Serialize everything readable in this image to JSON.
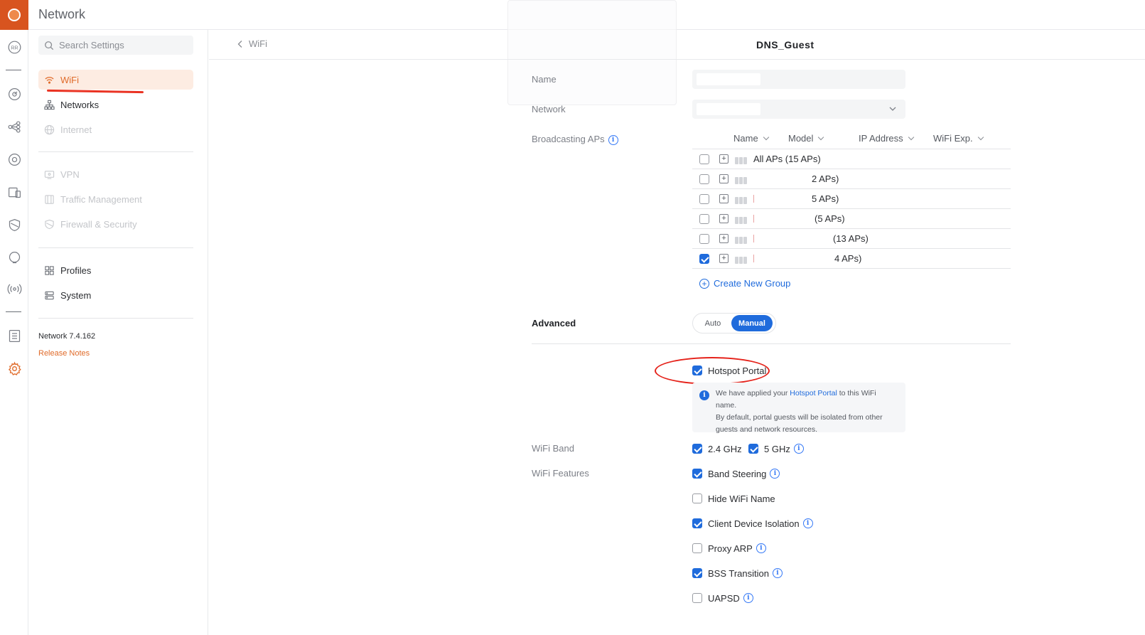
{
  "app": {
    "title": "Network"
  },
  "search": {
    "placeholder": "Search Settings"
  },
  "rail": {
    "avatar_initials": "RR"
  },
  "nav": {
    "items": [
      {
        "label": "WiFi",
        "icon": "wifi-icon"
      },
      {
        "label": "Networks",
        "icon": "networks-icon"
      },
      {
        "label": "Internet",
        "icon": "globe-icon"
      },
      {
        "label": "VPN",
        "icon": "vpn-icon"
      },
      {
        "label": "Traffic Management",
        "icon": "traffic-icon"
      },
      {
        "label": "Firewall & Security",
        "icon": "shield-icon"
      },
      {
        "label": "Profiles",
        "icon": "profiles-icon"
      },
      {
        "label": "System",
        "icon": "system-icon"
      }
    ],
    "version": "Network 7.4.162",
    "release_notes": "Release Notes"
  },
  "header": {
    "back_label": "WiFi",
    "page_title": "DNS_Guest"
  },
  "form": {
    "name_label": "Name",
    "network_label": "Network",
    "broadcasting_label": "Broadcasting APs",
    "ap_table": {
      "columns": [
        "Name",
        "Model",
        "IP Address",
        "WiFi Exp."
      ],
      "rows": [
        {
          "name": "All APs (15 APs)",
          "checked": false
        },
        {
          "name": "2 APs)",
          "checked": false
        },
        {
          "name": "5 APs)",
          "checked": false
        },
        {
          "name": "(5 APs)",
          "checked": false
        },
        {
          "name": "(13 APs)",
          "checked": false
        },
        {
          "name": "4 APs)",
          "checked": true
        }
      ]
    },
    "create_group": "Create New Group",
    "advanced_label": "Advanced",
    "advanced_mode": {
      "auto": "Auto",
      "manual": "Manual",
      "selected": "Manual"
    },
    "hotspot_portal": {
      "label": "Hotspot Portal",
      "checked": true
    },
    "notice": {
      "prefix": "We have applied your ",
      "link": "Hotspot Portal",
      "suffix": " to this WiFi name.",
      "line2": "By default, portal guests will be isolated from other",
      "line3": "guests and network resources."
    },
    "wifi_band_label": "WiFi Band",
    "bands": [
      {
        "label": "2.4 GHz",
        "checked": true
      },
      {
        "label": "5 GHz",
        "checked": true
      }
    ],
    "wifi_features_label": "WiFi Features",
    "features": [
      {
        "label": "Band Steering",
        "checked": true,
        "info": true
      },
      {
        "label": "Hide WiFi Name",
        "checked": false,
        "info": false
      },
      {
        "label": "Client Device Isolation",
        "checked": true,
        "info": true
      },
      {
        "label": "Proxy ARP",
        "checked": false,
        "info": true
      },
      {
        "label": "BSS Transition",
        "checked": true,
        "info": true
      },
      {
        "label": "UAPSD",
        "checked": false,
        "info": true
      }
    ]
  },
  "colors": {
    "accent": "#e06b2a",
    "primary": "#1f6bdc",
    "annotation": "#ea3323"
  }
}
